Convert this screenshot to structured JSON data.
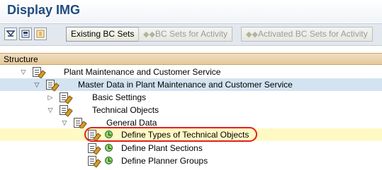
{
  "app": {
    "title": "Display IMG"
  },
  "toolbar": {
    "icons": [
      "filter-icon",
      "save-variant-icon",
      "bookmark-icon"
    ],
    "buttons": [
      {
        "label": "Existing BC Sets",
        "enabled": true
      },
      {
        "label": "BC Sets for Activity",
        "enabled": false
      },
      {
        "label": "Activated BC Sets for Activity",
        "enabled": false
      }
    ]
  },
  "tree": {
    "header": "Structure",
    "rows": [
      {
        "label": "Plant Maintenance and Customer Service",
        "expanded": true
      },
      {
        "label": "Master Data in Plant Maintenance and Customer Service",
        "expanded": true,
        "selected": true
      },
      {
        "label": "Basic Settings",
        "expanded": false
      },
      {
        "label": "Technical Objects",
        "expanded": true
      },
      {
        "label": "General Data",
        "expanded": true
      },
      {
        "label": "Define Types of Technical Objects",
        "highlighted": true,
        "circled": true
      },
      {
        "label": "Define Plant Sections"
      },
      {
        "label": "Define Planner Groups"
      }
    ]
  },
  "colors": {
    "title": "#1f4c7f",
    "toolbar_bg": "#e3e8ee",
    "header_bg": "#e6c99a",
    "selected_row": "#d4e3f1",
    "highlight_row": "#fff9c4",
    "circle": "#e02020"
  }
}
